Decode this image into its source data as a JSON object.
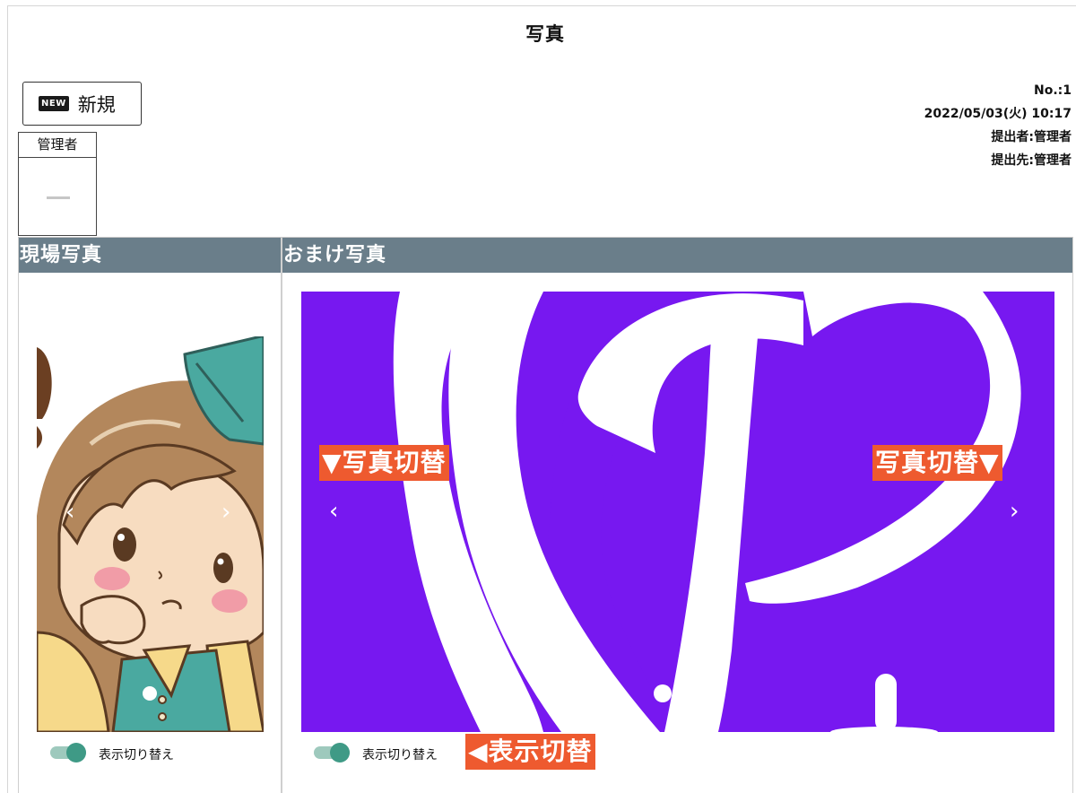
{
  "page": {
    "title": "写真"
  },
  "new_button": {
    "badge": "NEW",
    "label": "新規"
  },
  "stamp": {
    "title": "管理者"
  },
  "meta": {
    "number": "No.:1",
    "datetime": "2022/05/03(火) 10:17",
    "submitter": "提出者:管理者",
    "recipient": "提出先:管理者"
  },
  "panels": {
    "left": {
      "title": "現場写真",
      "toggle_label": "表示切り替え",
      "toggle_on": true
    },
    "right": {
      "title": "おまけ写真",
      "toggle_label": "表示切り替え",
      "toggle_on": true
    }
  },
  "annotations": {
    "switch_left": "▼写真切替",
    "switch_right": "写真切替▼",
    "display_switch": "◀表示切替"
  },
  "icons": {
    "prev": "chevron-left-icon",
    "next": "chevron-right-icon",
    "badge": "new-badge-icon"
  },
  "colors": {
    "panel_header": "#6a7e8a",
    "callout": "#ee5a2f",
    "photo_bg": "#7718f0",
    "toggle_on": "#3f9a86"
  }
}
